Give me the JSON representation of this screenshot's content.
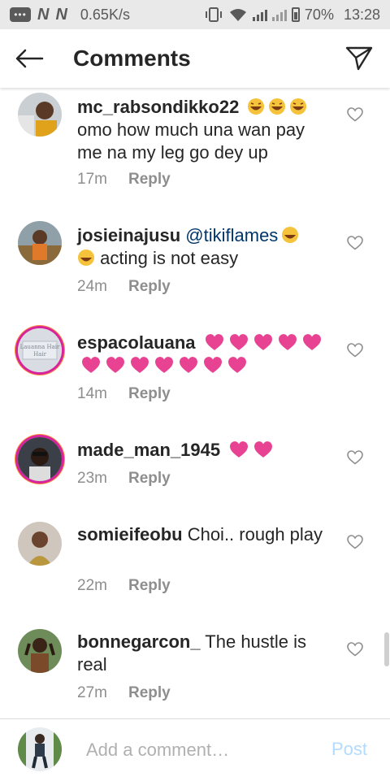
{
  "status_bar": {
    "net_speed": "0.65K/s",
    "battery": "70%",
    "time": "13:28",
    "n_logo": "N"
  },
  "header": {
    "title": "Comments"
  },
  "comments": [
    {
      "username": "mc_rabsondikko22",
      "text": "omo how much una wan pay me na my leg go dey up",
      "time": "17m",
      "reply": "Reply",
      "emoji": [
        "laugh",
        "laugh",
        "laugh"
      ]
    },
    {
      "username": "josieinajusu",
      "mention": "@tikiflames",
      "text": "acting is not easy",
      "time": "24m",
      "reply": "Reply"
    },
    {
      "username": "espacolauana",
      "avatar_text": "Lauanna Hair",
      "time": "14m",
      "reply": "Reply",
      "hearts": 12
    },
    {
      "username": "made_man_1945",
      "time": "23m",
      "reply": "Reply",
      "hearts": 2
    },
    {
      "username": "somieifeobu",
      "text": "Choi.. rough play",
      "time": "22m",
      "reply": "Reply"
    },
    {
      "username": "bonnegarcon_",
      "text": "The hustle is real",
      "time": "27m",
      "reply": "Reply"
    }
  ],
  "composer": {
    "placeholder": "Add a comment…",
    "post_label": "Post"
  },
  "colors": {
    "accent": "#b3dbff",
    "mention": "#003569",
    "heart_emoji": "#e84393",
    "muted": "#8e8e8e"
  }
}
